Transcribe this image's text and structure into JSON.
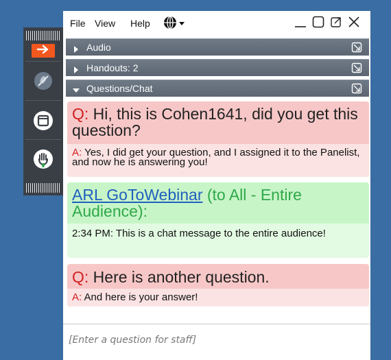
{
  "menu": {
    "file": "File",
    "view": "View",
    "help": "Help"
  },
  "sections": [
    {
      "label": "Audio",
      "state": "collapsed"
    },
    {
      "label": "Handouts: 2",
      "state": "collapsed"
    },
    {
      "label": "Questions/Chat",
      "state": "expanded"
    }
  ],
  "messages": [
    {
      "type": "question",
      "prefix": "Q:",
      "text": "Hi, this is Cohen1641, did you get this question?",
      "answer_prefix": "A:",
      "answer": "Yes, I did get your question, and I assigned it to the Panelist, and now he is answering you!"
    },
    {
      "type": "chat",
      "sender": "ARL GoToWebinar",
      "recipient": "(to All - Entire Audience):",
      "text": "2:34 PM: This is a chat message to the entire audience!"
    },
    {
      "type": "question",
      "prefix": "Q:",
      "text": "Here is another question.",
      "answer_prefix": "A:",
      "answer": "And here is your answer!"
    }
  ],
  "input": {
    "placeholder": "[Enter a question for staff]"
  },
  "colors": {
    "background": "#3a6da3",
    "strip": "#3a3f46",
    "accent_orange": "#f2571e",
    "section_header": "#647080",
    "question_bg": "#f7c7c7",
    "answer_bg": "#fbe3e3",
    "chat_bg": "#c8f5c8",
    "chat_sender": "#1f5fbf",
    "chat_recipient": "#2fa84a",
    "prefix_red": "#d11f1f"
  }
}
